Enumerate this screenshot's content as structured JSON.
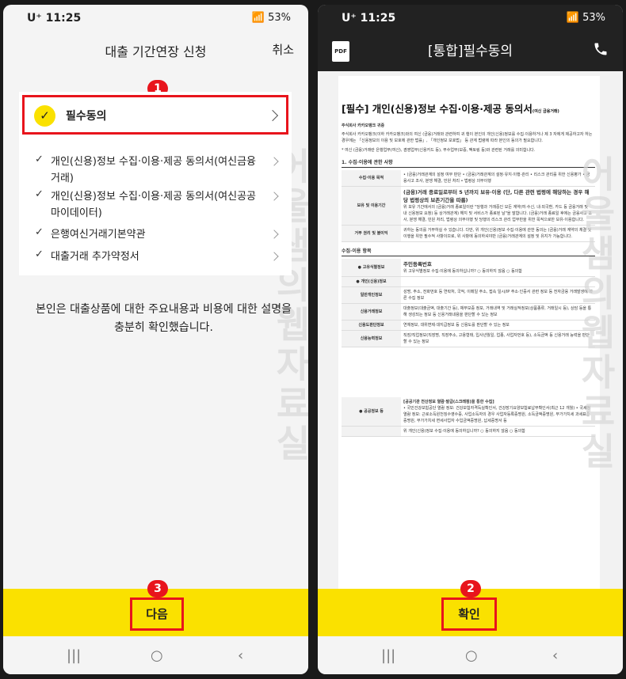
{
  "status": {
    "carrier": "U⁺",
    "time": "11:25",
    "battery": "53%"
  },
  "left": {
    "title": "대출 기간연장 신청",
    "cancel": "취소",
    "main_item": "필수동의",
    "sub_items": [
      {
        "label": "개인(신용)정보 수집·이용·제공 동의서(여신금융거래)"
      },
      {
        "label": "개인(신용)정보 수집·이용·제공 동의서(여신공공마이데이터)"
      },
      {
        "label": "은행여신거래기본약관"
      },
      {
        "label": "대출거래 추가약정서"
      }
    ],
    "notice": "본인은 대출상품에 대한 주요내용과 비용에 대한 설명을 충분히 확인했습니다.",
    "next_button": "다음",
    "watermark": "어울샘의웹자료실"
  },
  "right": {
    "title": "[통합]필수동의",
    "pdf_icon": "PDF",
    "confirm_button": "확인",
    "watermark": "어울샘의웹자료실",
    "doc": {
      "heading": "[필수] 개인(신용)정보 수집·이용·제공 동의서",
      "heading_small": "(여신 금융거래)",
      "company": "주식회사 카카오뱅크 귀중",
      "intro": "주식회사 카카오뱅크(이하 카카오뱅크)와의 여신 (금융)거래와 관련하여 귀 행이 본인의 개인(신용)정보를 수집·이용하거나 제 3 자에게 제공하고자 하는 경우에는 「신용정보의 이용 및 보호에 관한 법률」, 「개인정보 보호법」 등 관계 법령에 따라 본인의 동의가 필요합니다.",
      "note": "* 여신 (금융)거래란 은행업무(여신), 겸영업무(신용카드 등), 부수업무(보증, 팩토링 등)와 관련된 거래를 의미합니다.",
      "section1": "1. 수집·이용에 관한 사항",
      "rows": [
        {
          "k": "수집·이용 목적",
          "v": "• (금융)거래관계의 설정 여부 판단 • (금융)거래관계의 설정·유지·이행·관리 • 리스크 관리를 위한 신용평가 • 금융사고 조사, 분쟁 해결, 민원 처리 • 법령상 의무이행"
        },
        {
          "k": "보유 및 이용기간",
          "v_bold": "(금융)거래 종료일로부터 5 년까지 보유·이용 (단, 다른 관련 법령에 해당하는 경우 해당 법령상의 보존기간을 따름)",
          "v": "위 보유 기간에서의 (금융)거래 종료일이란 \"당행과 거래중인 모든 계약(여·수신, 내·외국환, 카드 등 금융거래 및 내 신용정보 요청) 등 상거래관계) 해지 및 서비스가 종료된 날\"을 말합니다. (금융)거래 종료일 후에는 금융사고 조사, 분쟁 해결, 민원 처리, 법령상 의무이행 및 당행의 리스크 관리 업무만을 위한 목적으로만 보유·이용합니다."
        },
        {
          "k": "거부 권리 및 불이익",
          "v": "귀하는 동의를 거부하실 수 있습니다. 다만, 위 개인(신용)정보 수집·이용에 관한 동의는 (금융)거래 계약의 체결 및 이행을 위한 필수적 사항이므로, 위 사항에 동의하셔야만 (금융)거래관계의 설정 및 유지가 가능합니다."
        }
      ],
      "section2": "수집·이용 항목",
      "items": [
        {
          "k": "● 고유식별정보",
          "v_bold": "주민등록번호",
          "v": "위 고유식별정보 수집·이용에 동의하십니까?  ○ 동의하지 않음  ○ 동의함"
        },
        {
          "k": "● 개인(신용)정보",
          "v": ""
        },
        {
          "k": "일반개인정보",
          "v": "성명, 주소, 전화번호 등 연락처, 국적, 이메일 주소, 접속 일시/IP 주소·인증서 관련 정보 등 전자금융 거래발생에 따른 수집 정보"
        },
        {
          "k": "신용거래정보",
          "v": "대출정보(대출금액, 대출기간 등), 채무보증 정보, 거래내역 및 거래실적정보(상품종류, 거래일시 등), 상담 등을 통해 생성되는 정보 등 신용거래내용을 판단할 수 있는 정보"
        },
        {
          "k": "신용도판단정보",
          "v": "연체정보, 대위변제·대지급정보 등 신용도를 판단할 수 있는 정보"
        },
        {
          "k": "신용능력정보",
          "v": "직장/직업정보(직장명, 직장주소, 고용형태, 입사년월일, 업종, 사업자번호 등), 소득금액 등 신용거래 능력을 판단할 수 있는 정보"
        },
        {
          "k": "● 공공정보 등",
          "v_bold": "[공공기관 전산정보 열람·발급(스크래핑)을 통한 수집]",
          "v": "• 국민건강보험공단 열람 정보: 건강보험자격득실확인서, 건강장기요양보험료납부확인서(최근 12 개월) • 국세청 열람 정보: 근로소득원천징수영수증, 사업소득자의 경우 사업자등록증명원, 소득금액증명원, 부가가치세 과세표준증명원, 부가가치세 면세사업자 수입금액증명원, 납세증명서 등"
        },
        {
          "k": "",
          "v": "위 개인(신용)정보 수집·이용에 동의하십니까?  ○ 동의하지 않음  ○ 동의함"
        }
      ]
    }
  },
  "badges": {
    "one": "1",
    "two": "2",
    "three": "3"
  },
  "nav": {
    "recent": "|||",
    "home": "○",
    "back": "‹"
  }
}
